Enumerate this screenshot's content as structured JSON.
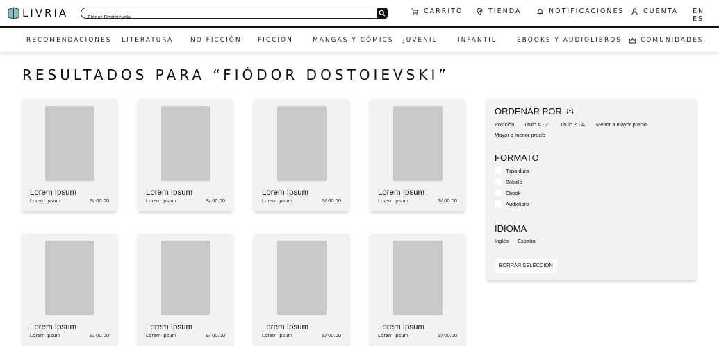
{
  "header": {
    "logo_text": "LIVRIA",
    "search": {
      "value": "Fiódor Dostoievski"
    },
    "links": [
      {
        "label": "CARRITO",
        "icon": "cart-icon"
      },
      {
        "label": "TIENDA",
        "icon": "location-pin-icon"
      },
      {
        "label": "NOTIFICACIONES",
        "icon": "bell-icon"
      },
      {
        "label": "CUENTA",
        "icon": "user-icon"
      }
    ],
    "language_toggle": "EN ES"
  },
  "categories": [
    {
      "label": "RECOMENDACIONES"
    },
    {
      "label": "LITERATURA"
    },
    {
      "label": "NO FICCIÓN"
    },
    {
      "label": "FICCIÓN"
    },
    {
      "label": "MANGAS Y CÓMICS"
    },
    {
      "label": "JUVENIL"
    },
    {
      "label": "INFANTIL"
    },
    {
      "label": "EBOOKS Y AUDIOLIBROS"
    },
    {
      "label": "COMUNIDADES",
      "icon": "crown-icon"
    }
  ],
  "results_title": "RESULTADOS PARA “FIÓDOR DOSTOIEVSKI”",
  "products": [
    {
      "title": "Lorem Ipsum",
      "author": "Lorem Ipsum",
      "price": "S/ 00.00"
    },
    {
      "title": "Lorem Ipsum",
      "author": "Lorem Ipsum",
      "price": "S/ 00.00"
    },
    {
      "title": "Lorem Ipsum",
      "author": "Lorem Ipsum",
      "price": "S/ 00.00"
    },
    {
      "title": "Lorem Ipsum",
      "author": "Lorem Ipsum",
      "price": "S/ 00.00"
    },
    {
      "title": "Lorem Ipsum",
      "author": "Lorem Ipsum",
      "price": "S/ 00.00"
    },
    {
      "title": "Lorem Ipsum",
      "author": "Lorem Ipsum",
      "price": "S/ 00.00"
    },
    {
      "title": "Lorem Ipsum",
      "author": "Lorem Ipsum",
      "price": "S/ 00.00"
    },
    {
      "title": "Lorem Ipsum",
      "author": "Lorem Ipsum",
      "price": "S/ 00.00"
    }
  ],
  "filters": {
    "sort": {
      "title": "ORDENAR POR",
      "options": [
        "Posición",
        "Titulo A - Z",
        "Titulo Z - A",
        "Menor a mayor precio",
        "Mayor a menor precio"
      ]
    },
    "format": {
      "title": "FORMATO",
      "options": [
        "Tapa dura",
        "Bolsillo",
        "Ebook",
        "Audiolibro"
      ]
    },
    "language": {
      "title": "IDIOMA",
      "options": [
        "Inglés",
        "Español"
      ]
    },
    "clear_label": "BORRAR SELECCIÓN"
  },
  "colors": {
    "accent": "#111111",
    "card_bg": "#f2f2f2",
    "cover_placeholder": "#c9c9c9"
  }
}
